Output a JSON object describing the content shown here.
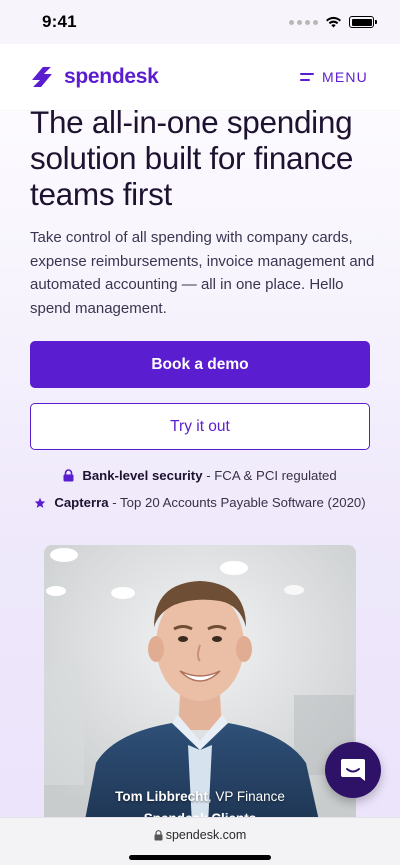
{
  "status_bar": {
    "time": "9:41"
  },
  "nav": {
    "brand": "spendesk",
    "menu_label": "MENU"
  },
  "hero": {
    "title": "The all-in-one spending solution built for finance teams first",
    "description": "Take control of all spending with company cards, expense reimbursements, invoice management and automated accounting — all in one place. Hello spend management."
  },
  "buttons": {
    "primary": "Book a demo",
    "secondary": "Try it out"
  },
  "trust": [
    {
      "bold": "Bank-level security",
      "rest": " - FCA & PCI regulated",
      "icon": "lock-icon"
    },
    {
      "bold": "Capterra",
      "rest": " - Top 20 Accounts Payable Software (2020)",
      "icon": "star-icon"
    }
  ],
  "testimonial": {
    "name": "Tom Libbrecht",
    "role": ", VP Finance",
    "company": "Spendesk Clients"
  },
  "browser": {
    "url": "spendesk.com"
  },
  "colors": {
    "brand": "#5b1dd0",
    "chat": "#2d1268"
  }
}
